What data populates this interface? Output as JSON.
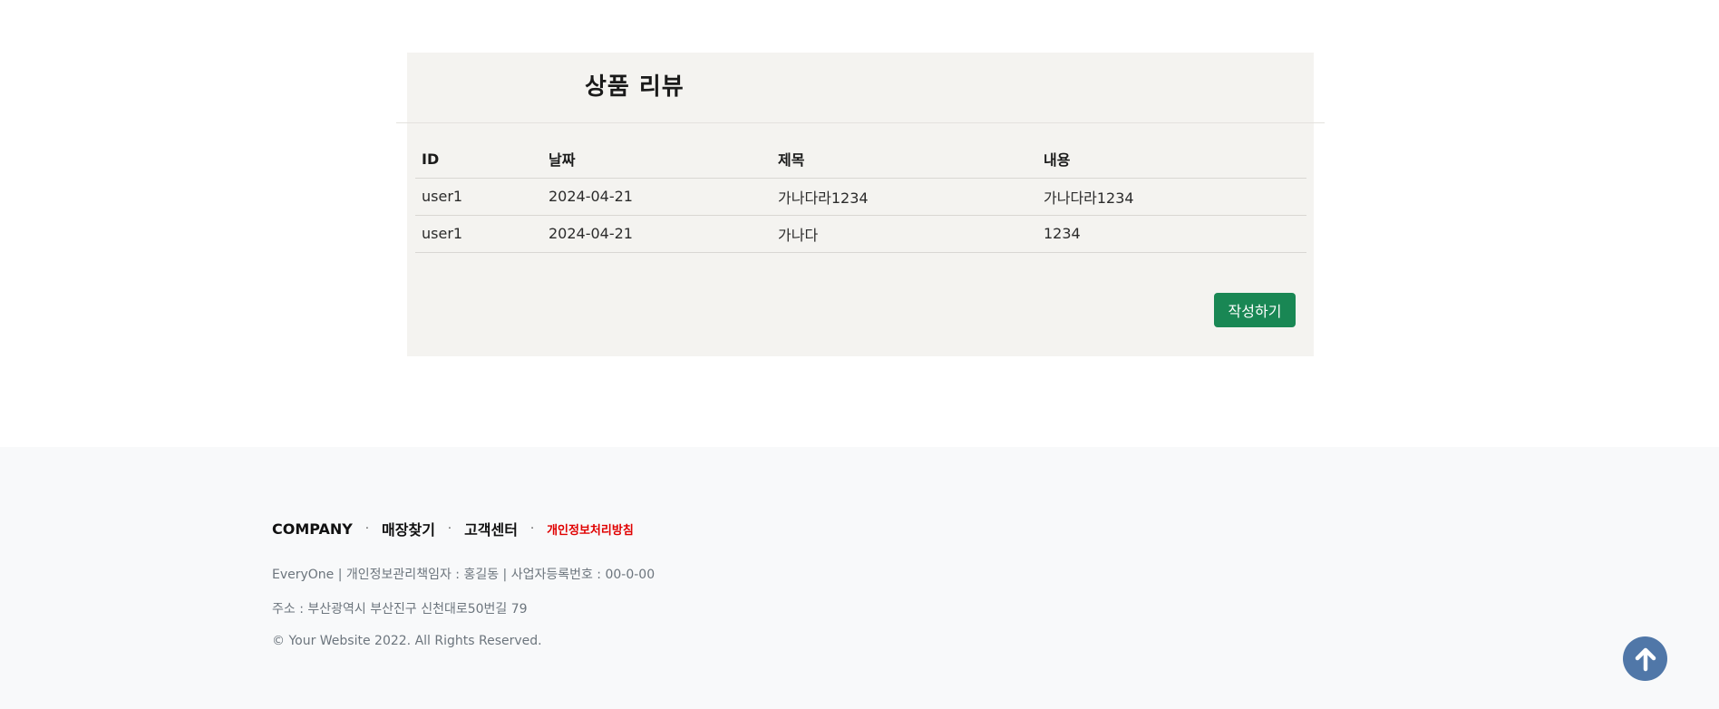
{
  "review": {
    "title": "상품 리뷰",
    "columns": [
      "ID",
      "날짜",
      "제목",
      "내용"
    ],
    "rows": [
      [
        "user1",
        "2024-04-21",
        "가나다라1234",
        "가나다라1234"
      ],
      [
        "user1",
        "2024-04-21",
        "가나다",
        "1234"
      ]
    ],
    "write_button": "작성하기",
    "write_button_color": "#198754"
  },
  "footer": {
    "nav": {
      "company": "COMPANY",
      "sep": "·",
      "store_finder": "매장찾기",
      "customer_center": "고객센터",
      "privacy_policy": "개인정보처리방침"
    },
    "info_line": "EveryOne | 개인정보관리책임자 : 홍길동 | 사업자등록번호 : 00-0-00",
    "address_line": "주소 : 부산광역시 부산진구 신천대로50번길 79",
    "copyright": "© Your Website 2022. All Rights Reserved."
  },
  "scroll_top": {
    "icon": "arrow-up-icon",
    "color": "#5077a8"
  }
}
